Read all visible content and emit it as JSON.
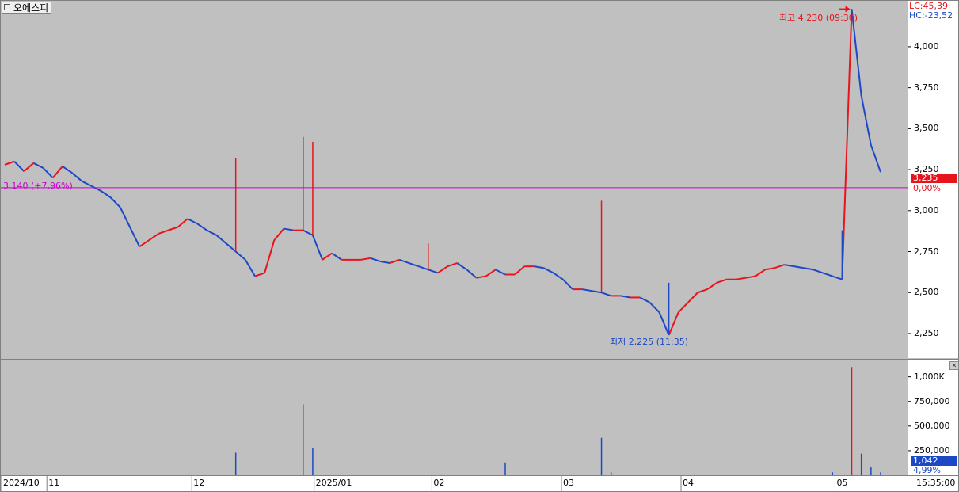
{
  "title": "오에스피",
  "legend": {
    "lc": "LC:45,39",
    "hc": "HC:-23,52"
  },
  "price_axis": {
    "ticks": [
      "4,000",
      "3,750",
      "3,500",
      "3,250",
      "3,000",
      "2,750",
      "2,500",
      "2,250"
    ]
  },
  "volume_axis": {
    "ticks": [
      "1,000K",
      "750,000",
      "500,000",
      "250,000"
    ]
  },
  "last_price": {
    "value": "3,235",
    "change": "0,00%"
  },
  "last_volume": {
    "value": "1,042",
    "change": "4,99%"
  },
  "reference_line_label": "3,140 (+7,96%)",
  "annotations": {
    "high": "최고 4,230 (09:30)",
    "low": "최저 2,225 (11:35)"
  },
  "time_labels": [
    "2024/10",
    "11",
    "12",
    "2025/01",
    "02",
    "03",
    "04",
    "05"
  ],
  "clock": "15:35:00",
  "colors": {
    "up": "#e8141c",
    "down": "#1c48c8",
    "reference": "#cc00cc",
    "background": "#c0c0c0",
    "axis_bg": "#ffffff"
  },
  "chart_data": {
    "type": "line",
    "title": "오에스피",
    "ylim": [
      2100,
      4280
    ],
    "y_ticks": [
      2250,
      2500,
      2750,
      3000,
      3250,
      3500,
      3750,
      4000
    ],
    "reference_level": 3140,
    "last": 3235,
    "high": {
      "value": 4230,
      "time": "09:30"
    },
    "low": {
      "value": 2225,
      "time": "11:35"
    },
    "x_labels": [
      "2024/10",
      "11",
      "12",
      "2025/01",
      "02",
      "03",
      "04",
      "05"
    ],
    "series": [
      {
        "values": [
          3280,
          3300,
          3240,
          3290,
          3260,
          3200,
          3270,
          3230,
          3180,
          3150,
          3120,
          3080,
          3020,
          2900,
          2780,
          2820,
          2860,
          2880,
          2900,
          2950,
          2920,
          2880,
          2850,
          2800,
          2750,
          2700,
          2600,
          2620,
          2820,
          2890,
          2880,
          2880,
          2850,
          2700,
          2740,
          2700,
          2700,
          2700,
          2710,
          2690,
          2680,
          2700,
          2680,
          2660,
          2640,
          2620,
          2660,
          2680,
          2640,
          2590,
          2600,
          2640,
          2610,
          2610,
          2660,
          2660,
          2650,
          2620,
          2580,
          2520,
          2520,
          2510,
          2500,
          2480,
          2480,
          2470,
          2470,
          2440,
          2380,
          2240,
          2380,
          2440,
          2500,
          2520,
          2560,
          2580,
          2580,
          2590,
          2600,
          2640,
          2650,
          2670,
          2660,
          2650,
          2640,
          2620,
          2600,
          2580,
          4230,
          3700,
          3400,
          3235
        ],
        "spikes_high": [
          null,
          null,
          null,
          null,
          null,
          null,
          null,
          null,
          null,
          null,
          null,
          null,
          null,
          null,
          null,
          null,
          null,
          null,
          null,
          null,
          null,
          null,
          null,
          null,
          3320,
          null,
          null,
          null,
          null,
          null,
          null,
          3450,
          3420,
          null,
          null,
          null,
          null,
          null,
          null,
          null,
          null,
          null,
          null,
          null,
          2800,
          null,
          null,
          null,
          null,
          null,
          null,
          null,
          null,
          null,
          null,
          null,
          null,
          null,
          null,
          null,
          null,
          null,
          3060,
          null,
          null,
          null,
          null,
          null,
          null,
          2560,
          null,
          null,
          null,
          null,
          null,
          null,
          null,
          null,
          null,
          null,
          null,
          null,
          null,
          null,
          null,
          null,
          null,
          2880,
          4230,
          null,
          null,
          null
        ]
      }
    ],
    "volume_ylim": [
      0,
      1150000
    ],
    "volume_y_ticks": [
      250000,
      500000,
      750000,
      1000000
    ],
    "volume": [
      5000,
      4000,
      3000,
      5000,
      4000,
      3000,
      6000,
      4000,
      3000,
      5000,
      8000,
      4000,
      3000,
      5000,
      4000,
      3000,
      6000,
      4000,
      3000,
      5000,
      4000,
      3000,
      5000,
      4000,
      230000,
      5000,
      4000,
      3000,
      5000,
      6000,
      4000,
      720000,
      280000,
      5000,
      4000,
      3000,
      5000,
      4000,
      3000,
      5000,
      4000,
      3000,
      5000,
      6000,
      4000,
      3000,
      5000,
      4000,
      3000,
      5000,
      4000,
      3000,
      130000,
      4000,
      3000,
      5000,
      4000,
      3000,
      5000,
      4000,
      6000,
      3000,
      380000,
      30000,
      3000,
      5000,
      4000,
      3000,
      5000,
      4000,
      3000,
      5000,
      4000,
      3000,
      5000,
      4000,
      3000,
      6000,
      4000,
      3000,
      5000,
      4000,
      3000,
      5000,
      4000,
      3000,
      30000,
      5000,
      1100000,
      220000,
      80000,
      30000
    ]
  }
}
